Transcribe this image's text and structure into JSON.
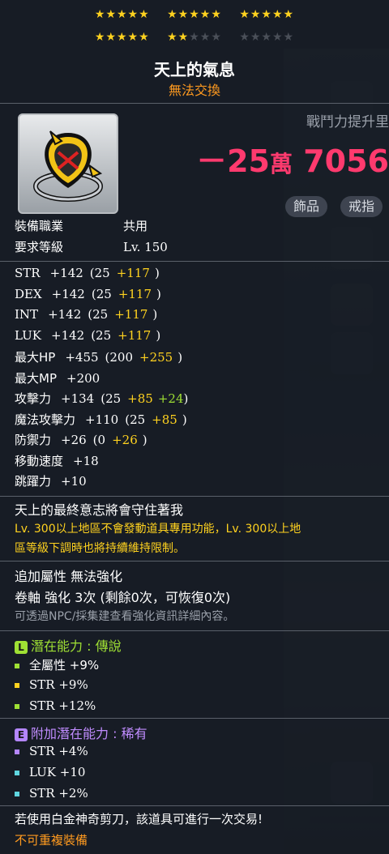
{
  "stars": {
    "row1": [
      "★★★★★",
      "★★★★★",
      "★★★★★"
    ],
    "row2_on": [
      "★★★★★",
      "★★"
    ],
    "row2_off": [
      "★★★",
      "★★★★★"
    ]
  },
  "item": {
    "name": "天上的氣息",
    "trade": "無法交換",
    "icon": "shield-ring-icon"
  },
  "power": {
    "label": "戰鬥力提升里",
    "sign": "－",
    "value_main": "25",
    "unit": "萬",
    "value_rest": "7056"
  },
  "tags": [
    "飾品",
    "戒指"
  ],
  "requirements": [
    {
      "label": "裝備職業",
      "value": "共用"
    },
    {
      "label": "要求等級",
      "value": "Lv. 150"
    }
  ],
  "stats": [
    {
      "name": "STR",
      "base": "+142",
      "paren_open": "(25",
      "bonus": "+117",
      "bonus2": "",
      "paren_close": ")"
    },
    {
      "name": "DEX",
      "base": "+142",
      "paren_open": "(25",
      "bonus": "+117",
      "bonus2": "",
      "paren_close": ")"
    },
    {
      "name": "INT",
      "base": "+142",
      "paren_open": "(25",
      "bonus": "+117",
      "bonus2": "",
      "paren_close": ")"
    },
    {
      "name": "LUK",
      "base": "+142",
      "paren_open": "(25",
      "bonus": "+117",
      "bonus2": "",
      "paren_close": ")"
    },
    {
      "name": "最大HP",
      "base": "+455",
      "paren_open": "(200",
      "bonus": "+255",
      "bonus2": "",
      "paren_close": ")"
    },
    {
      "name": "最大MP",
      "base": "+200",
      "paren_open": "",
      "bonus": "",
      "bonus2": "",
      "paren_close": ""
    },
    {
      "name": "攻擊力",
      "base": "+134",
      "paren_open": "(25",
      "bonus": "+85",
      "bonus2": "+24",
      "paren_close": ")"
    },
    {
      "name": "魔法攻擊力",
      "base": "+110",
      "paren_open": "(25",
      "bonus": "+85",
      "bonus2": "",
      "paren_close": ")"
    },
    {
      "name": "防禦力",
      "base": "+26",
      "paren_open": "(0",
      "bonus": "+26",
      "bonus2": "",
      "paren_close": ")"
    },
    {
      "name": "移動速度",
      "base": "+18",
      "paren_open": "",
      "bonus": "",
      "bonus2": "",
      "paren_close": ""
    },
    {
      "name": "跳躍力",
      "base": "+10",
      "paren_open": "",
      "bonus": "",
      "bonus2": "",
      "paren_close": ""
    }
  ],
  "description": {
    "line1": "天上的最終意志將會守住著我",
    "line2": "Lv. 300以上地區不會發動道具專用功能，Lv. 300以上地",
    "line3": "區等級下調時也將持續維持限制。"
  },
  "extra": {
    "additional": "追加屬性 無法強化",
    "scroll": "卷軸 強化 3次 (剩餘0次，可恢復0次)",
    "hint": "可透過NPC/採集建查看強化資訊詳細內容。"
  },
  "potential": {
    "badge": "L",
    "title": "潛在能力",
    "colon": ":",
    "grade": "傳說",
    "lines": [
      "全屬性 +9%",
      "STR +9%",
      "STR +12%"
    ]
  },
  "bonus_potential": {
    "badge": "E",
    "title": "附加潛在能力",
    "colon": ":",
    "grade": "稀有",
    "lines": [
      "STR +4%",
      "LUK +10",
      "STR +2%"
    ]
  },
  "footer": {
    "scissors": "若使用白金神奇剪刀，該道具可進行一次交易!",
    "unique": "不可重複裝備"
  },
  "colors": {
    "star": "#ffd21f",
    "power": "#ff3a6e",
    "legend": "#9fe034",
    "rare": "#b486ff",
    "orange": "#ff9a1f"
  }
}
